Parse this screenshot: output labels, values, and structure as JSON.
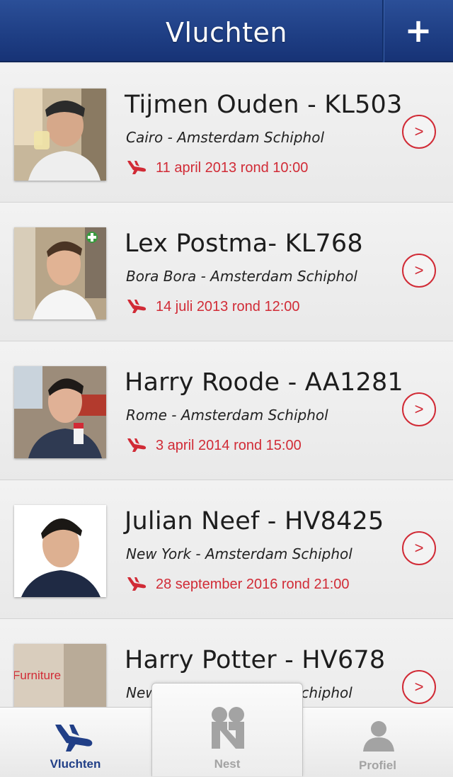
{
  "header": {
    "title": "Vluchten",
    "add_label": "+"
  },
  "flights": [
    {
      "name": "Tijmen Ouden - KL503",
      "route": "Cairo - Amsterdam Schiphol",
      "date": "11 april 2013 rond 10:00",
      "action": ">"
    },
    {
      "name": "Lex Postma- KL768",
      "route": "Bora Bora - Amsterdam Schiphol",
      "date": "14 juli 2013 rond 12:00",
      "action": ">"
    },
    {
      "name": "Harry Roode - AA1281",
      "route": "Rome - Amsterdam Schiphol",
      "date": "3 april 2014 rond 15:00",
      "action": ">"
    },
    {
      "name": "Julian Neef - HV8425",
      "route": "New York - Amsterdam Schiphol",
      "date": "28 september 2016 rond 21:00",
      "action": ">"
    },
    {
      "name": "Harry Potter - HV678",
      "route": "New York - Amsterdam Schiphol",
      "date": "",
      "action": ">",
      "photo_text": "Furniture"
    }
  ],
  "tabbar": {
    "tabs": [
      {
        "label": "Vluchten",
        "icon": "plane-icon",
        "selected": true
      },
      {
        "label": "Nest",
        "icon": "nest-icon",
        "selected": false
      },
      {
        "label": "Profiel",
        "icon": "profile-icon",
        "selected": false
      }
    ]
  },
  "colors": {
    "header_blue": "#1f3f85",
    "accent_red": "#d12b36",
    "selected_tab": "#213f87",
    "inactive_tab": "#a3a3a3"
  }
}
